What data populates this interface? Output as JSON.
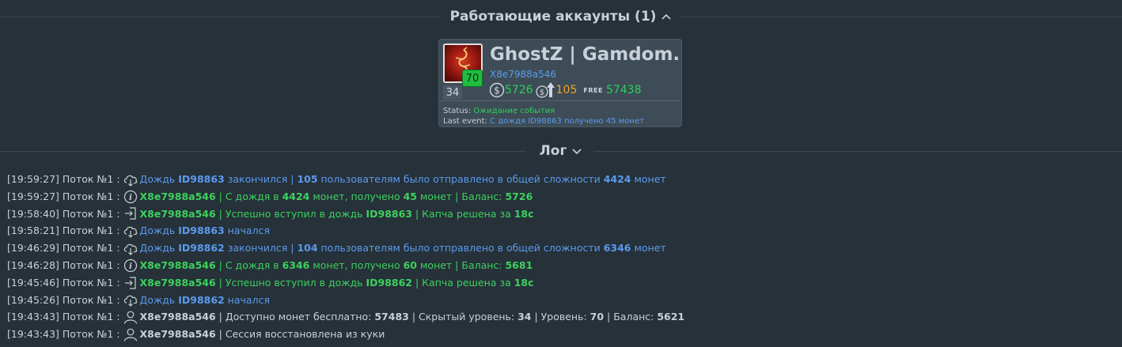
{
  "accounts_section": {
    "title": "Работающие аккаунты (1)"
  },
  "account": {
    "name": "GhostZ | Gamdom...",
    "id": "X8e7988a546",
    "level": "70",
    "hidden_level": "34",
    "balance": "5726",
    "bonus": "105",
    "free_label": "FREE",
    "free_coins": "57438",
    "status_label": "Status:",
    "status_value": "Ожидание события",
    "last_event_label": "Last event:",
    "last_event_value": "С дождя ID98863 получено 45 монет"
  },
  "log_section": {
    "title": "Лог"
  },
  "log": [
    {
      "time": "[19:59:27]",
      "thread": "Поток №1 :",
      "icon": "cloud-icon",
      "parts": [
        [
          "blue",
          "Дождь "
        ],
        [
          "blueb",
          "ID98863"
        ],
        [
          "blue",
          " закончился | "
        ],
        [
          "blueb",
          "105"
        ],
        [
          "blue",
          " пользователям было отправлено в общей сложности "
        ],
        [
          "blueb",
          "4424"
        ],
        [
          "blue",
          " монет"
        ]
      ]
    },
    {
      "time": "[19:59:27]",
      "thread": "Поток №1 :",
      "icon": "info-icon",
      "parts": [
        [
          "greenb",
          "X8e7988a546"
        ],
        [
          "green",
          " | С дождя в "
        ],
        [
          "greenb",
          "4424"
        ],
        [
          "green",
          " монет, получено "
        ],
        [
          "greenb",
          "45"
        ],
        [
          "green",
          " монет | Баланс: "
        ],
        [
          "greenb",
          "5726"
        ]
      ]
    },
    {
      "time": "[19:58:40]",
      "thread": "Поток №1 :",
      "icon": "enter-icon",
      "parts": [
        [
          "greenb",
          "X8e7988a546"
        ],
        [
          "green",
          " | Успешно вступил в дождь "
        ],
        [
          "greenb",
          "ID98863"
        ],
        [
          "green",
          " | Капча решена за "
        ],
        [
          "greenb",
          "18c"
        ]
      ]
    },
    {
      "time": "[19:58:21]",
      "thread": "Поток №1 :",
      "icon": "cloud-icon",
      "parts": [
        [
          "blue",
          "Дождь "
        ],
        [
          "blueb",
          "ID98863"
        ],
        [
          "blue",
          " начался"
        ]
      ]
    },
    {
      "time": "[19:46:29]",
      "thread": "Поток №1 :",
      "icon": "cloud-icon",
      "parts": [
        [
          "blue",
          "Дождь "
        ],
        [
          "blueb",
          "ID98862"
        ],
        [
          "blue",
          " закончился | "
        ],
        [
          "blueb",
          "104"
        ],
        [
          "blue",
          " пользователям было отправлено в общей сложности "
        ],
        [
          "blueb",
          "6346"
        ],
        [
          "blue",
          " монет"
        ]
      ]
    },
    {
      "time": "[19:46:28]",
      "thread": "Поток №1 :",
      "icon": "info-icon",
      "parts": [
        [
          "greenb",
          "X8e7988a546"
        ],
        [
          "green",
          " | С дождя в "
        ],
        [
          "greenb",
          "6346"
        ],
        [
          "green",
          " монет, получено "
        ],
        [
          "greenb",
          "60"
        ],
        [
          "green",
          " монет | Баланс: "
        ],
        [
          "greenb",
          "5681"
        ]
      ]
    },
    {
      "time": "[19:45:46]",
      "thread": "Поток №1 :",
      "icon": "enter-icon",
      "parts": [
        [
          "greenb",
          "X8e7988a546"
        ],
        [
          "green",
          " | Успешно вступил в дождь "
        ],
        [
          "greenb",
          "ID98862"
        ],
        [
          "green",
          " | Капча решена за "
        ],
        [
          "greenb",
          "18c"
        ]
      ]
    },
    {
      "time": "[19:45:26]",
      "thread": "Поток №1 :",
      "icon": "cloud-icon",
      "parts": [
        [
          "blue",
          "Дождь "
        ],
        [
          "blueb",
          "ID98862"
        ],
        [
          "blue",
          " начался"
        ]
      ]
    },
    {
      "time": "[19:43:43]",
      "thread": "Поток №1 :",
      "icon": "user-icon",
      "parts": [
        [
          "whiteb",
          "X8e7988a546"
        ],
        [
          "white",
          " | Доступно монет бесплатно: "
        ],
        [
          "whiteb",
          "57483"
        ],
        [
          "white",
          " | Скрытый уровень: "
        ],
        [
          "whiteb",
          "34"
        ],
        [
          "white",
          " | Уровень: "
        ],
        [
          "whiteb",
          "70"
        ],
        [
          "white",
          " | Баланс: "
        ],
        [
          "whiteb",
          "5621"
        ]
      ]
    },
    {
      "time": "[19:43:43]",
      "thread": "Поток №1 :",
      "icon": "user-icon",
      "parts": [
        [
          "whiteb",
          "X8e7988a546"
        ],
        [
          "white",
          " | Сессия восстановлена из куки"
        ]
      ]
    }
  ]
}
